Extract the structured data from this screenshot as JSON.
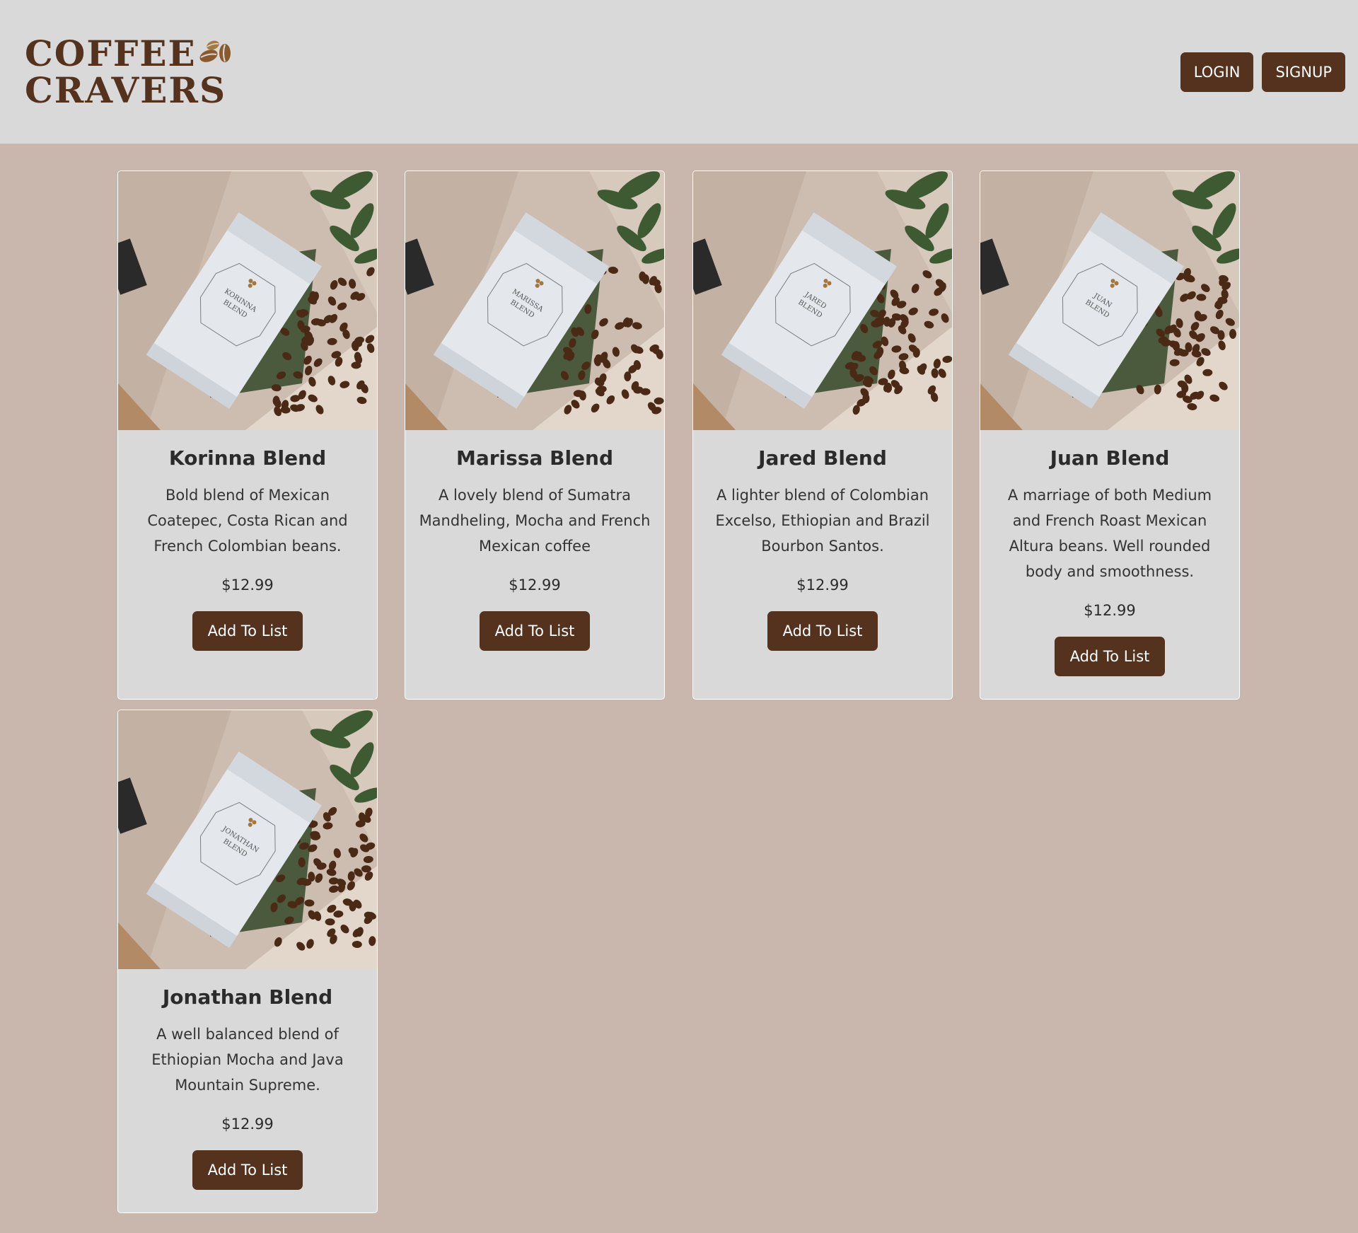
{
  "brand": {
    "line1": "COFFEE",
    "line2": "CRAVERS",
    "icon": "coffee-beans-icon"
  },
  "nav": {
    "login_label": "LOGIN",
    "signup_label": "SIGNUP"
  },
  "colors": {
    "brand": "#55321e",
    "header_bg": "#d9d9d9",
    "page_bg": "#c9b7ad",
    "card_bg": "#d9d9d9"
  },
  "products": [
    {
      "name": "Korinna Blend",
      "description": "Bold blend of Mexican Coatepec, Costa Rican and French Colombian beans.",
      "price": "$12.99",
      "button_label": "Add To List",
      "bag_label_line1": "KORINNA",
      "bag_label_line2": "BLEND"
    },
    {
      "name": "Marissa Blend",
      "description": "A lovely blend of Sumatra Mandheling, Mocha and French Mexican coffee",
      "price": "$12.99",
      "button_label": "Add To List",
      "bag_label_line1": "MARISSA",
      "bag_label_line2": "BLEND"
    },
    {
      "name": "Jared Blend",
      "description": "A lighter blend of Colombian Excelso, Ethiopian and Brazil Bourbon Santos.",
      "price": "$12.99",
      "button_label": "Add To List",
      "bag_label_line1": "JARED",
      "bag_label_line2": "BLEND"
    },
    {
      "name": "Juan Blend",
      "description": "A marriage of both Medium and French Roast Mexican Altura beans. Well rounded body and smoothness.",
      "price": "$12.99",
      "button_label": "Add To List",
      "bag_label_line1": "JUAN",
      "bag_label_line2": "BLEND"
    },
    {
      "name": "Jonathan Blend",
      "description": "A well balanced blend of Ethiopian Mocha and Java Mountain Supreme.",
      "price": "$12.99",
      "button_label": "Add To List",
      "bag_label_line1": "JONATHAN",
      "bag_label_line2": "BLEND"
    }
  ]
}
